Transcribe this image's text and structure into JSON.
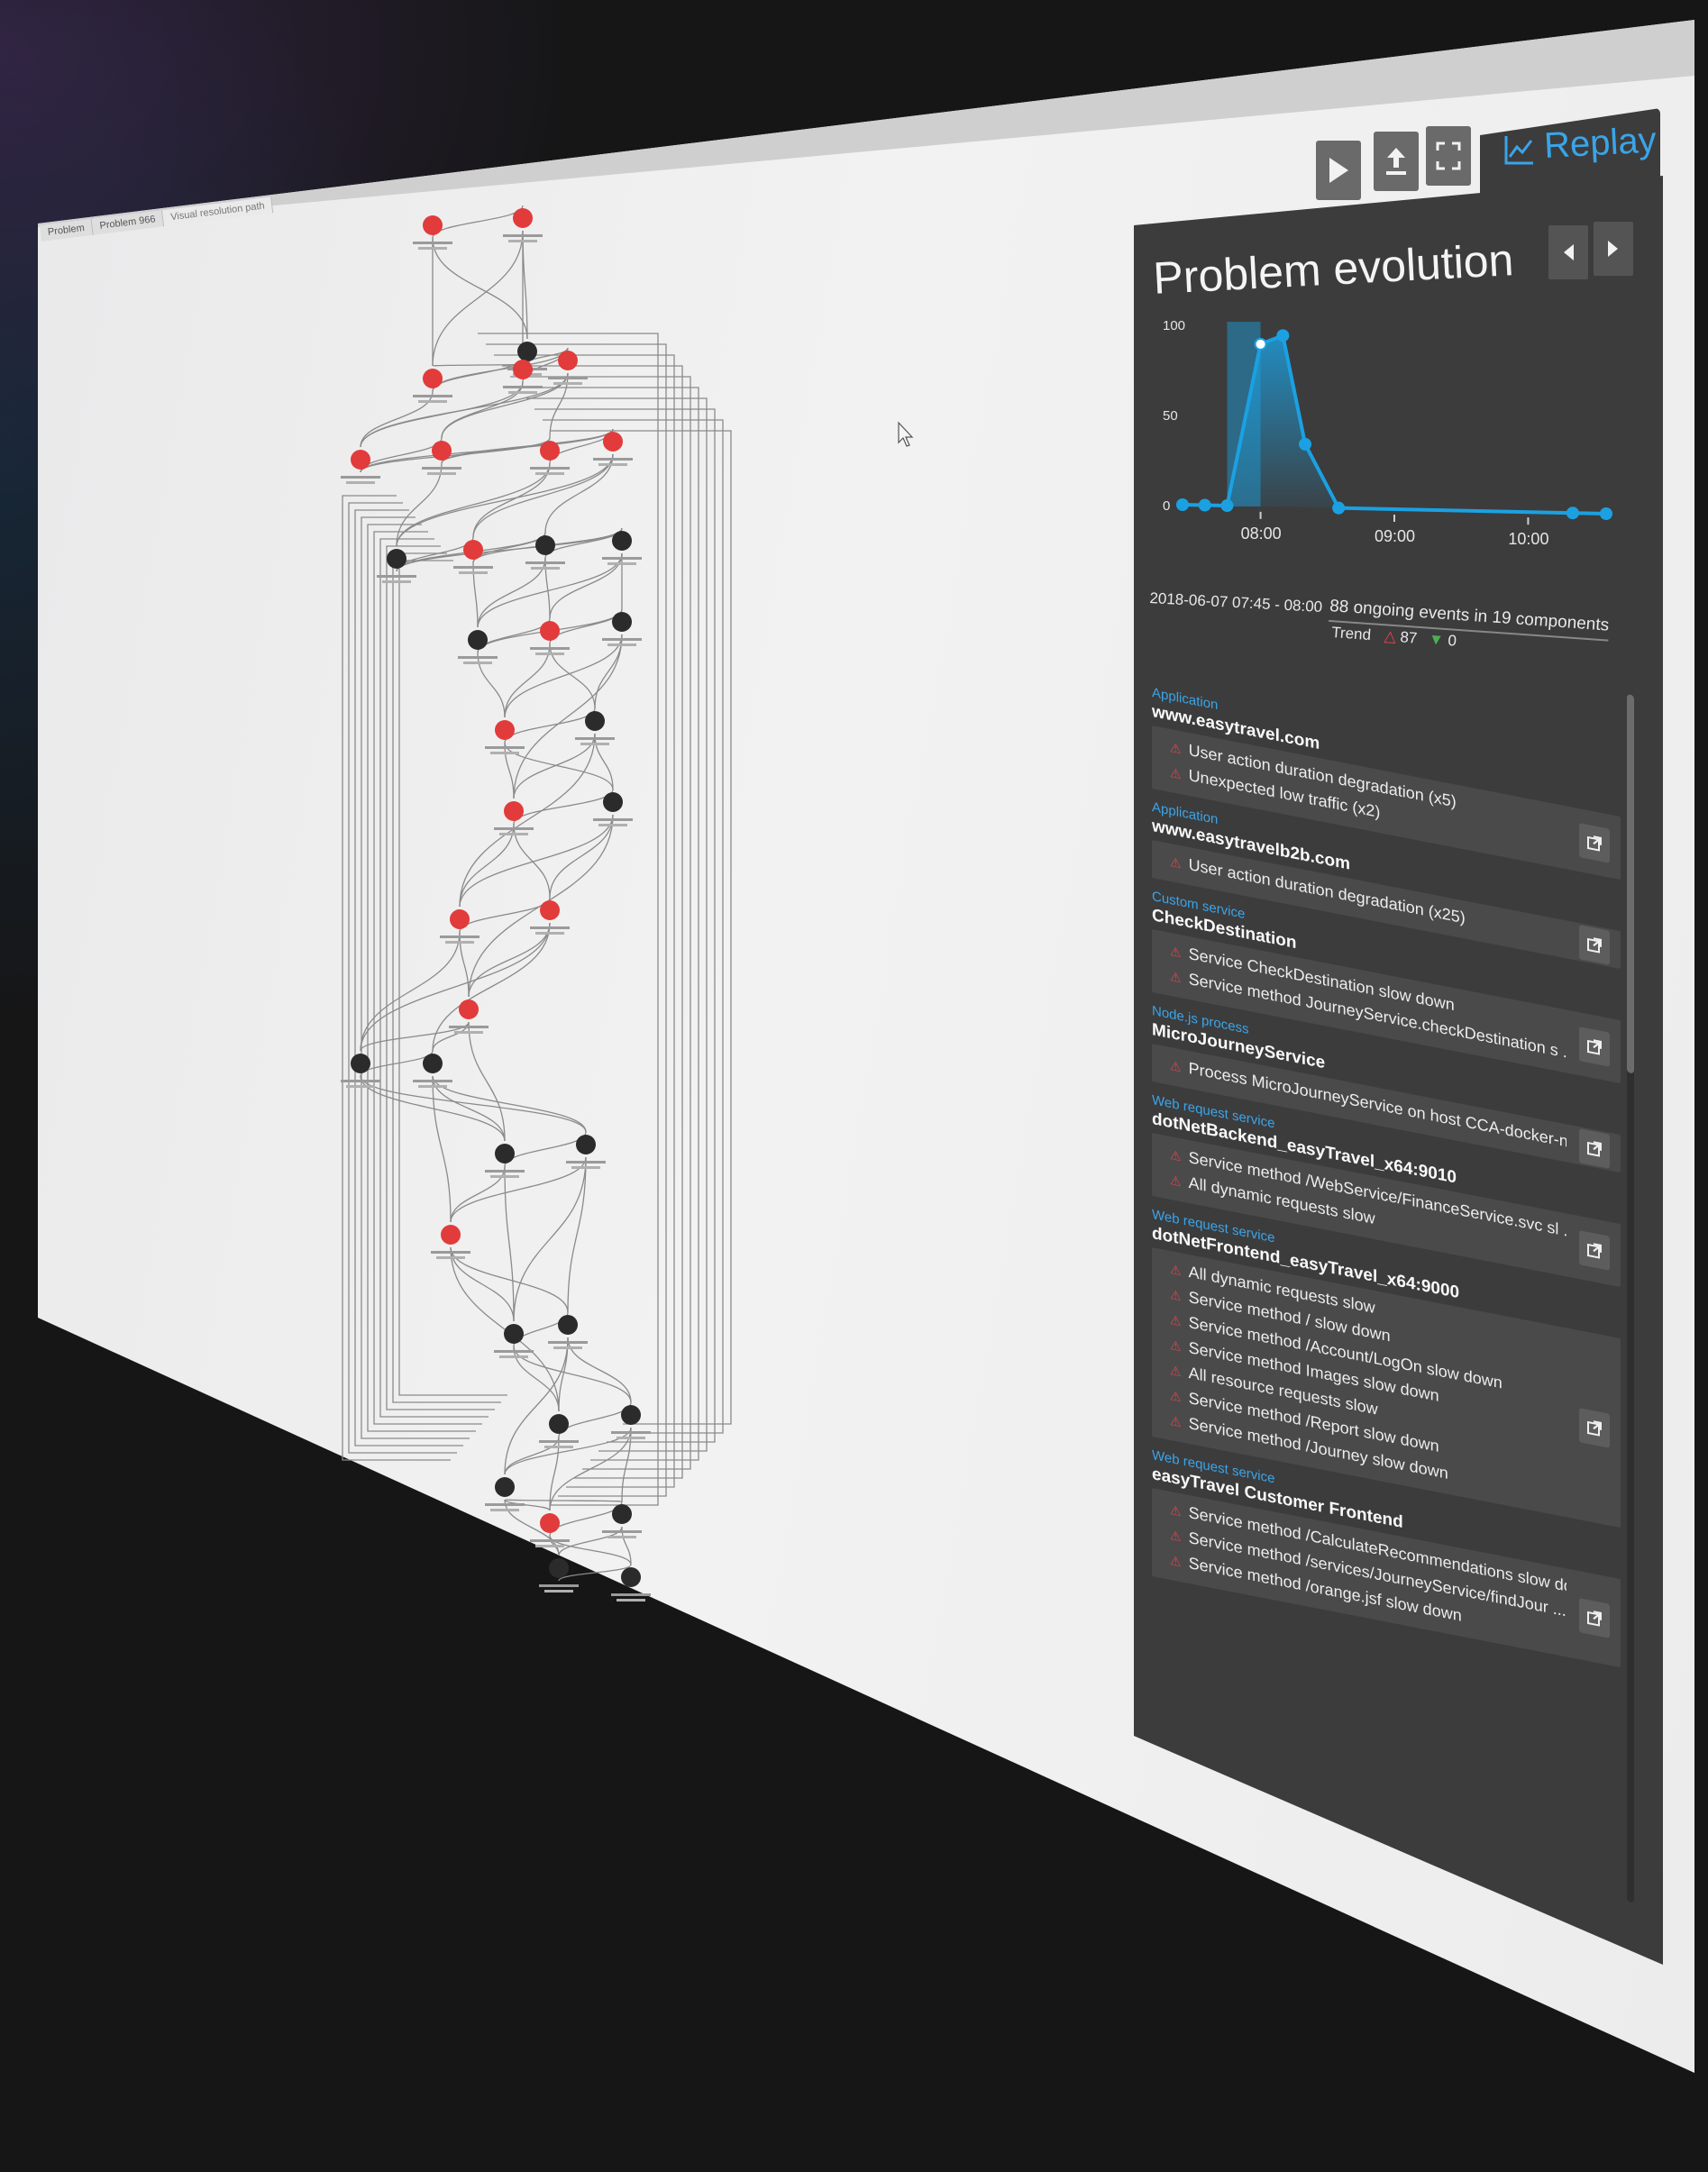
{
  "breadcrumbs": [
    "Problem",
    "Problem 966",
    "Visual resolution path"
  ],
  "toolbar": {
    "play_icon": "play-icon",
    "export_icon": "export-icon",
    "fullscreen_icon": "expand-icon",
    "replay_label": "Replay"
  },
  "panel": {
    "title": "Problem evolution",
    "prev_icon": "chevron-left-icon",
    "next_icon": "chevron-right-icon",
    "time_range": "2018-06-07 07:45 - 08:00",
    "summary": "88 ongoing events in 19 components",
    "trend_label": "Trend",
    "trend_up": "87",
    "trend_down": "0"
  },
  "chart_data": {
    "type": "line",
    "y_ticks": [
      "100",
      "50",
      "0"
    ],
    "x_ticks": [
      "08:00",
      "09:00",
      "10:00"
    ],
    "ylim": [
      0,
      100
    ],
    "x": [
      "07:25",
      "07:35",
      "07:45",
      "08:00",
      "08:10",
      "08:20",
      "08:35",
      "10:20",
      "10:35"
    ],
    "values": [
      0,
      0,
      0,
      90,
      95,
      35,
      0,
      0,
      0
    ],
    "highlight": {
      "from": "07:45",
      "to": "08:00"
    },
    "color": "#1ba1e2"
  },
  "events": [
    {
      "type": "Application",
      "name": "www.easytravel.com",
      "items": [
        "User action duration degradation (x5)",
        "Unexpected low traffic (x2)"
      ]
    },
    {
      "type": "Application",
      "name": "www.easytravelb2b.com",
      "items": [
        "User action duration degradation (x25)"
      ]
    },
    {
      "type": "Custom service",
      "name": "CheckDestination",
      "items": [
        "Service CheckDestination slow down",
        "Service method JourneyService.checkDestination s ..."
      ]
    },
    {
      "type": "Node.js process",
      "name": "MicroJourneyService",
      "items": [
        "Process MicroJourneyService on host CCA-docker-n ..."
      ]
    },
    {
      "type": "Web request service",
      "name": "dotNetBackend_easyTravel_x64:9010",
      "items": [
        "Service method /WebService/FinanceService.svc sl ...",
        "All dynamic requests slow"
      ]
    },
    {
      "type": "Web request service",
      "name": "dotNetFrontend_easyTravel_x64:9000",
      "items": [
        "All dynamic requests slow",
        "Service method / slow down",
        "Service method /Account/LogOn slow down",
        "Service method Images slow down",
        "All resource requests slow",
        "Service method /Report slow down",
        "Service method /Journey slow down"
      ]
    },
    {
      "type": "Web request service",
      "name": "easyTravel Customer Frontend",
      "items": [
        "Service method /CalculateRecommendations slow down",
        "Service method /services/JourneyService/findJour ...",
        "Service method /orange.jsf slow down"
      ]
    }
  ],
  "colors": {
    "accent": "#1ba1e2",
    "alert": "#e8414d",
    "panel": "#3c3c3d",
    "canvas": "#f0f0f0"
  }
}
